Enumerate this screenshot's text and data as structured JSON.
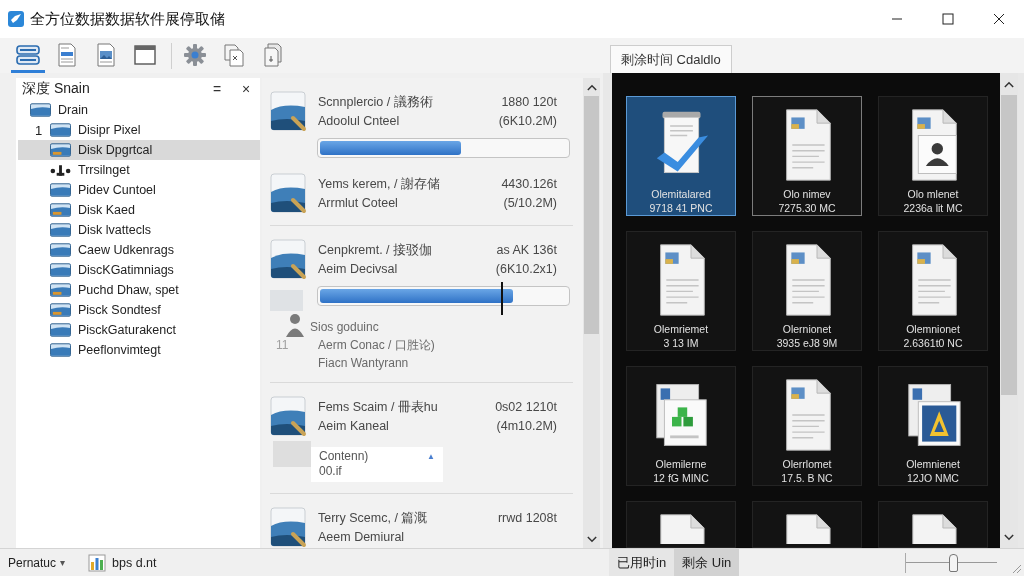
{
  "window": {
    "title": "全方位数据数据软件展停取储"
  },
  "toolbar": {
    "groups": [
      [
        {
          "kind": "disks",
          "selected": true
        },
        {
          "kind": "document",
          "selected": false
        },
        {
          "kind": "image-document",
          "selected": false
        },
        {
          "kind": "window",
          "selected": false
        }
      ],
      [
        {
          "kind": "gear",
          "selected": false
        },
        {
          "kind": "copy",
          "selected": false
        },
        {
          "kind": "file-stack",
          "selected": false
        }
      ]
    ],
    "panel_tab": {
      "label": "剩涂时间 Cdaldlo"
    }
  },
  "tree_panel": {
    "title": "深度 Snain",
    "menu_glyph": "=",
    "close_glyph": "×",
    "root": {
      "label": "Drain",
      "kind": "drive",
      "selected": false,
      "children": [
        {
          "number": "1",
          "label": "Disipr Pixel",
          "kind": "drive",
          "selected": false
        },
        {
          "label": "Disk Dpgrtcal",
          "kind": "drive-tag",
          "selected": true
        },
        {
          "label": "Trrsilnget",
          "kind": "plug",
          "selected": false
        },
        {
          "label": "Pidev Cuntoel",
          "kind": "drive",
          "selected": false
        },
        {
          "label": "Disk Kaed",
          "kind": "drive-tag",
          "selected": false
        },
        {
          "label": "Disk lvattecls",
          "kind": "drive",
          "selected": false
        },
        {
          "label": "Caew Udkenrags",
          "kind": "drive",
          "selected": false
        },
        {
          "label": "DiscKGatimniags",
          "kind": "drive",
          "selected": false
        },
        {
          "label": "Puchd Dhaw, spet",
          "kind": "drive-tag",
          "selected": false
        },
        {
          "label": "Pisck Sondtesf",
          "kind": "drive-tag",
          "selected": false
        },
        {
          "label": "PisckGaturakenct",
          "kind": "drive",
          "selected": false
        },
        {
          "label": "Peeflonvimtegt",
          "kind": "drive",
          "selected": false
        }
      ]
    }
  },
  "list": {
    "groups": [
      {
        "entries": [
          {
            "title": "Scnnplercio / 議務術",
            "subtitle": "Adoolul Cnteel",
            "size": "1880 120t",
            "detail": "(6K10.2M)",
            "level": 0.57
          },
          {
            "title": "Yems kerem, / 謝存储",
            "subtitle": "Arrmlut Coteel",
            "size": "4430.126t",
            "detail": "(5/10.2M)"
          }
        ]
      },
      {
        "entries": [
          {
            "title": "Cenpkremt. / 接驳伽",
            "subtitle": "Aeim Decivsal",
            "size": "as AK 136t",
            "detail": "(6K10.2x1)",
            "level": 0.78
          }
        ],
        "drag_preview": {
          "caption": "Sios goduinc",
          "index": "11",
          "title": "Aerm Conac / 口胜论)",
          "subtitle": "Fiacn Wantyrann"
        }
      },
      {
        "entries": [
          {
            "title": "Fems Scaim / 冊表hu",
            "subtitle": "Aeim Kaneal",
            "size": "0s02 1210t",
            "detail": "(4m10.2M)",
            "attachment": {
              "label": "Contenn)",
              "glyph": "▲",
              "value": "00.if"
            }
          }
        ]
      },
      {
        "entries": [
          {
            "title": "Terry Scemc, / 篇溉",
            "subtitle": "Aeem Demiural",
            "size": "rrwd 1208t"
          }
        ]
      }
    ]
  },
  "gallery": {
    "tiles": [
      {
        "kind": "checked",
        "name": "Olemitalared",
        "size": "9718 41 PNC",
        "selected": true,
        "outlined": false
      },
      {
        "kind": "picture",
        "name": "Olo nimev",
        "size": "7275.30 MC",
        "selected": false,
        "outlined": true
      },
      {
        "kind": "profile",
        "name": "Olo mlenet",
        "size": "2236a lit MC",
        "selected": false,
        "outlined": false
      },
      {
        "kind": "picture",
        "name": "Olemriemet",
        "size": "3 13 IM",
        "selected": false,
        "outlined": false
      },
      {
        "kind": "picture",
        "name": "Olernionet",
        "size": "3935 eJ8 9M",
        "selected": false,
        "outlined": false
      },
      {
        "kind": "picture",
        "name": "Olemnionet",
        "size": "2.6361t0 NC",
        "selected": false,
        "outlined": false
      },
      {
        "kind": "cubes",
        "name": "Olemilerne",
        "size": "12 fG MINC",
        "selected": false,
        "outlined": false
      },
      {
        "kind": "picture",
        "name": "Olerrlomet",
        "size": "17.5. B NC",
        "selected": false,
        "outlined": false
      },
      {
        "kind": "pyramid",
        "name": "Olemnienet",
        "size": "12JO NMC",
        "selected": false,
        "outlined": false
      },
      {
        "kind": "plain",
        "selected": false,
        "outlined": false
      },
      {
        "kind": "plain",
        "selected": false,
        "outlined": false
      },
      {
        "kind": "plain",
        "selected": false,
        "outlined": false
      }
    ]
  },
  "status_bar": {
    "view_menu": {
      "label": "Pernatuc",
      "caret": "▾"
    },
    "info": {
      "label": "bps d.nt"
    },
    "tabs": [
      {
        "label": "已用时in",
        "selected": false
      },
      {
        "label": "剩余 Uin",
        "selected": true
      }
    ],
    "zoom_slider": {
      "level": 0.52
    }
  }
}
